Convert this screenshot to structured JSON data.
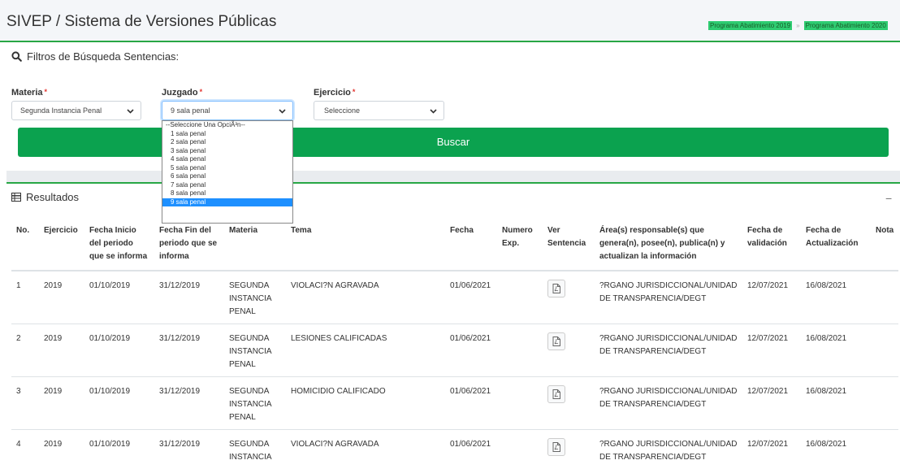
{
  "header": {
    "title": "SIVEP / Sistema de Versiones Públicas",
    "breadcrumbs": [
      "Programa Abatimiento 2019",
      "Programa Abatimiento 2020"
    ],
    "breadcrumb_sep": "»"
  },
  "filters": {
    "title": "Filtros de Búsqueda Sentencias:",
    "materia": {
      "label": "Materia",
      "value": "Segunda Instancia Penal"
    },
    "juzgado": {
      "label": "Juzgado",
      "value": "9 sala penal",
      "options": [
        "--Seleccione Una OpciÃ³n--",
        "1 sala penal",
        "2 sala penal",
        "3 sala penal",
        "4 sala penal",
        "5 sala penal",
        "6 sala penal",
        "7 sala penal",
        "8 sala penal",
        "9 sala penal"
      ]
    },
    "ejercicio": {
      "label": "Ejercicio",
      "value": "Seleccione"
    },
    "required_mark": "*",
    "search_button": "Buscar"
  },
  "results": {
    "title": "Resultados",
    "collapse": "−",
    "columns": [
      "No.",
      "Ejercicio",
      "Fecha Inicio del periodo que se informa",
      "Fecha Fin del periodo que se informa",
      "Materia",
      "Tema",
      "Fecha",
      "Numero Exp.",
      "Ver Sentencia",
      "Área(s) responsable(s) que genera(n), posee(n), publica(n) y actualizan la información",
      "Fecha de validación",
      "Fecha de Actualización",
      "Nota"
    ],
    "rows": [
      [
        "1",
        "2019",
        "01/10/2019",
        "31/12/2019",
        "SEGUNDA INSTANCIA PENAL",
        "VIOLACI?N AGRAVADA",
        "01/06/2021",
        "",
        "",
        "?RGANO JURISDICCIONAL/UNIDAD DE TRANSPARENCIA/DEGT",
        "12/07/2021",
        "16/08/2021",
        ""
      ],
      [
        "2",
        "2019",
        "01/10/2019",
        "31/12/2019",
        "SEGUNDA INSTANCIA PENAL",
        "LESIONES CALIFICADAS",
        "01/06/2021",
        "",
        "",
        "?RGANO JURISDICCIONAL/UNIDAD DE TRANSPARENCIA/DEGT",
        "12/07/2021",
        "16/08/2021",
        ""
      ],
      [
        "3",
        "2019",
        "01/10/2019",
        "31/12/2019",
        "SEGUNDA INSTANCIA PENAL",
        "HOMICIDIO CALIFICADO",
        "01/06/2021",
        "",
        "",
        "?RGANO JURISDICCIONAL/UNIDAD DE TRANSPARENCIA/DEGT",
        "12/07/2021",
        "16/08/2021",
        ""
      ],
      [
        "4",
        "2019",
        "01/10/2019",
        "31/12/2019",
        "SEGUNDA INSTANCIA",
        "VIOLACI?N AGRAVADA",
        "01/06/2021",
        "",
        "",
        "?RGANO JURISDICCIONAL/UNIDAD DE TRANSPARENCIA/DEGT",
        "12/07/2021",
        "16/08/2021",
        ""
      ]
    ]
  },
  "colors": {
    "accent": "#28a745",
    "button": "#0ba24f",
    "selected_option": "#1e90ff"
  },
  "icons": [
    "search-icon",
    "table-icon",
    "pdf-icon",
    "chevron-down-icon"
  ]
}
